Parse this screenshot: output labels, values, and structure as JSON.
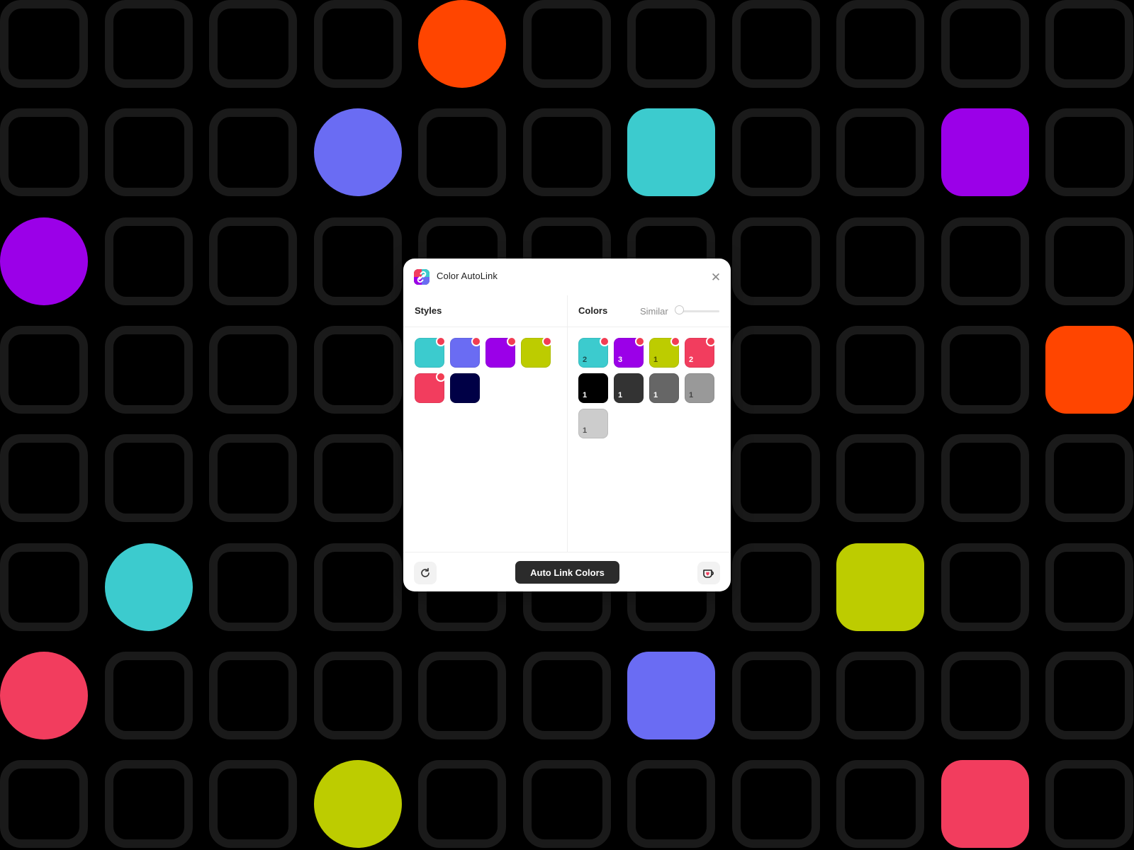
{
  "background": {
    "color": "#000000",
    "empty_tile_color": "#1a1a1a",
    "colored_tiles": [
      {
        "row": 0,
        "col": 4,
        "shape": "circle",
        "color": "#ff4500"
      },
      {
        "row": 1,
        "col": 3,
        "shape": "circle",
        "color": "#6a6cf3"
      },
      {
        "row": 1,
        "col": 6,
        "shape": "square",
        "color": "#3ccbce"
      },
      {
        "row": 1,
        "col": 9,
        "shape": "square",
        "color": "#9b00e8"
      },
      {
        "row": 2,
        "col": 0,
        "shape": "circle",
        "color": "#9b00e8"
      },
      {
        "row": 3,
        "col": 10,
        "shape": "square",
        "color": "#ff4500"
      },
      {
        "row": 5,
        "col": 1,
        "shape": "circle",
        "color": "#3ccbce"
      },
      {
        "row": 5,
        "col": 8,
        "shape": "square",
        "color": "#bdcc00"
      },
      {
        "row": 6,
        "col": 0,
        "shape": "circle",
        "color": "#f23d5e"
      },
      {
        "row": 6,
        "col": 6,
        "shape": "square",
        "color": "#6a6cf3"
      },
      {
        "row": 7,
        "col": 3,
        "shape": "circle",
        "color": "#bdcc00"
      },
      {
        "row": 7,
        "col": 9,
        "shape": "square",
        "color": "#f23d5e"
      }
    ]
  },
  "dialog": {
    "title": "Color AutoLink",
    "app_icon": "chain-link-icon",
    "close_icon": "close-icon",
    "close_glyph": "✕",
    "styles": {
      "title": "Styles",
      "swatches": [
        {
          "color": "#3ccbce",
          "badge": true
        },
        {
          "color": "#6a6cf3",
          "badge": true
        },
        {
          "color": "#9b00e8",
          "badge": true
        },
        {
          "color": "#bdcc00",
          "badge": true
        },
        {
          "color": "#f23d5e",
          "badge": true
        },
        {
          "color": "#000046",
          "badge": false
        }
      ]
    },
    "colors": {
      "title": "Colors",
      "similar_label": "Similar",
      "similar_value": 0,
      "swatches": [
        {
          "color": "#3ccbce",
          "count": "2",
          "badge": true,
          "text_color": "#1d4f50"
        },
        {
          "color": "#9b00e8",
          "count": "3",
          "badge": true,
          "text_color": "#ffffff"
        },
        {
          "color": "#bdcc00",
          "count": "1",
          "badge": true,
          "text_color": "#4b5100"
        },
        {
          "color": "#f23d5e",
          "count": "2",
          "badge": true,
          "text_color": "#ffffff"
        },
        {
          "color": "#000000",
          "count": "1",
          "badge": false,
          "text_color": "#ffffff"
        },
        {
          "color": "#333333",
          "count": "1",
          "badge": false,
          "text_color": "#ffffff"
        },
        {
          "color": "#666666",
          "count": "1",
          "badge": false,
          "text_color": "#ffffff"
        },
        {
          "color": "#999999",
          "count": "1",
          "badge": false,
          "text_color": "#444444"
        },
        {
          "color": "#cccccc",
          "count": "1",
          "badge": false,
          "text_color": "#555555"
        }
      ]
    },
    "footer": {
      "refresh_icon": "refresh-icon",
      "primary_label": "Auto Link Colors",
      "support_icon": "coffee-heart-icon"
    }
  }
}
